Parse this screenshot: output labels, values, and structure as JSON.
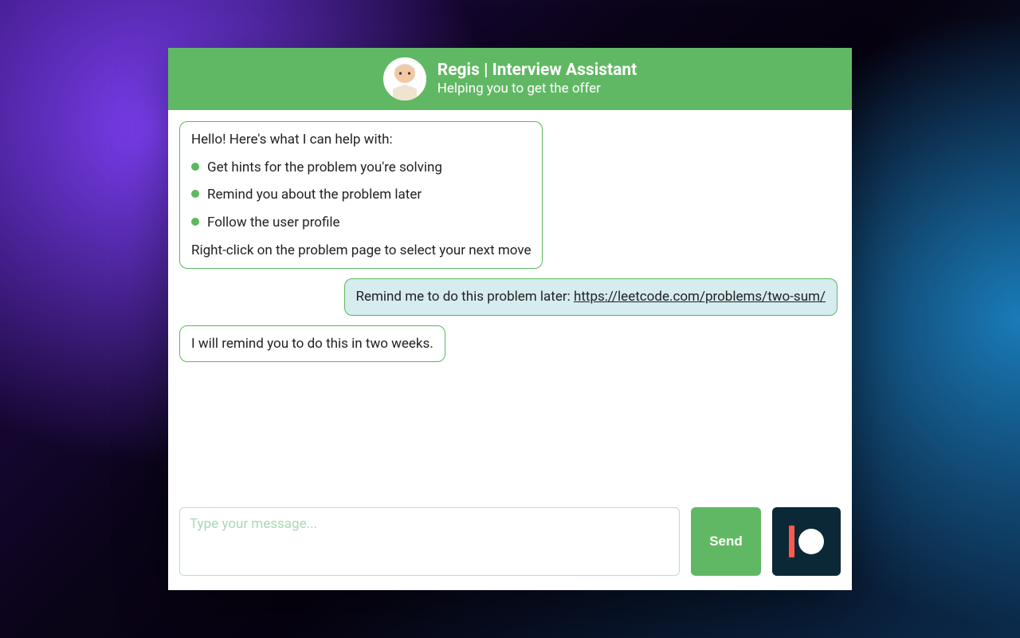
{
  "header": {
    "title": "Regis | Interview Assistant",
    "subtitle": "Helping you to get the offer"
  },
  "messages": {
    "bot1": {
      "intro": "Hello! Here's what I can help with:",
      "bullets": [
        "Get hints for the problem you're solving",
        "Remind you about the problem later",
        "Follow the user profile"
      ],
      "outro": "Right-click on the problem page to select your next move"
    },
    "user1": {
      "prefix": "Remind me to do this problem later: ",
      "link_text": "https://leetcode.com/problems/two-sum/",
      "link_href": "https://leetcode.com/problems/two-sum/"
    },
    "bot2": {
      "text": "I will remind you to do this in two weeks."
    }
  },
  "composer": {
    "placeholder": "Type your message...",
    "send_label": "Send"
  },
  "icons": {
    "avatar": "wise-man-avatar",
    "patreon": "patreon-icon"
  },
  "colors": {
    "accent": "#61b864",
    "user_bubble": "#d6ecef",
    "patreon_bg": "#0b2836",
    "patreon_bar": "#ff5a4f"
  }
}
